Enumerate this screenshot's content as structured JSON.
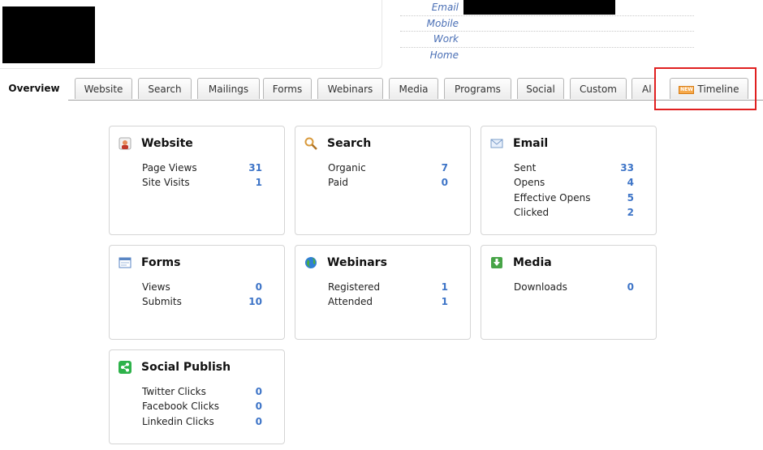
{
  "contact": {
    "labels": [
      "Email",
      "Mobile",
      "Work",
      "Home"
    ]
  },
  "tabs": [
    {
      "label": "Overview",
      "active": true
    },
    {
      "label": "Website"
    },
    {
      "label": "Search"
    },
    {
      "label": "Mailings"
    },
    {
      "label": "Forms"
    },
    {
      "label": "Webinars"
    },
    {
      "label": "Media"
    },
    {
      "label": "Programs"
    },
    {
      "label": "Social"
    },
    {
      "label": "Custom"
    },
    {
      "label": "Al"
    },
    {
      "label": "Timeline",
      "badge": "NEW"
    }
  ],
  "cards": {
    "website": {
      "title": "Website",
      "metrics": [
        {
          "label": "Page Views",
          "value": "31"
        },
        {
          "label": "Site Visits",
          "value": "1"
        }
      ]
    },
    "search": {
      "title": "Search",
      "metrics": [
        {
          "label": "Organic",
          "value": "7"
        },
        {
          "label": "Paid",
          "value": "0"
        }
      ]
    },
    "email": {
      "title": "Email",
      "metrics": [
        {
          "label": "Sent",
          "value": "33"
        },
        {
          "label": "Opens",
          "value": "4"
        },
        {
          "label": "Effective Opens",
          "value": "5"
        },
        {
          "label": "Clicked",
          "value": "2"
        }
      ]
    },
    "forms": {
      "title": "Forms",
      "metrics": [
        {
          "label": "Views",
          "value": "0"
        },
        {
          "label": "Submits",
          "value": "10"
        }
      ]
    },
    "webinars": {
      "title": "Webinars",
      "metrics": [
        {
          "label": "Registered",
          "value": "1"
        },
        {
          "label": "Attended",
          "value": "1"
        }
      ]
    },
    "media": {
      "title": "Media",
      "metrics": [
        {
          "label": "Downloads",
          "value": "0"
        }
      ]
    },
    "social": {
      "title": "Social Publish",
      "metrics": [
        {
          "label": "Twitter Clicks",
          "value": "0"
        },
        {
          "label": "Facebook Clicks",
          "value": "0"
        },
        {
          "label": "Linkedin Clicks",
          "value": "0"
        }
      ]
    }
  },
  "colors": {
    "accent": "#3d74c7",
    "highlight": "#e02020",
    "badge": "#f6a94b"
  }
}
